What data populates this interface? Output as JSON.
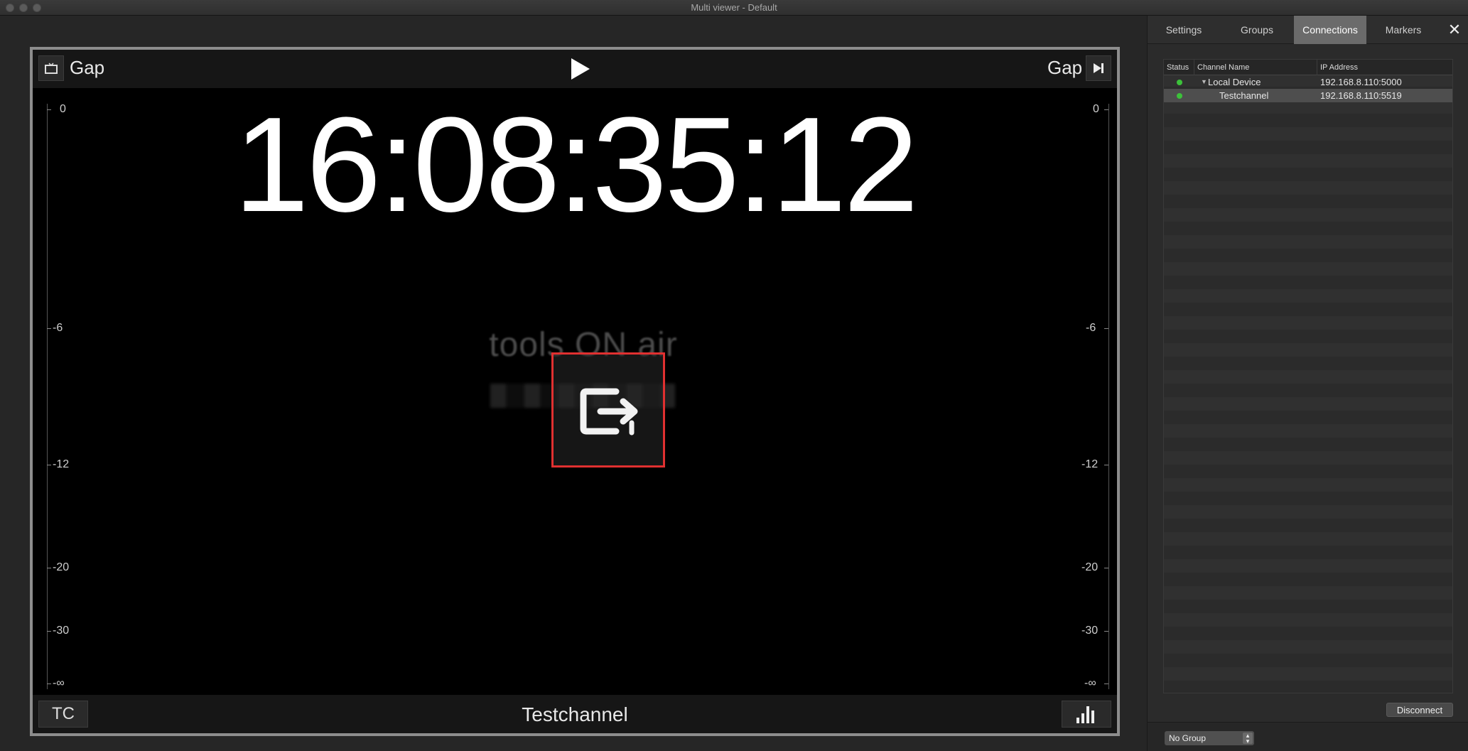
{
  "window": {
    "title": "Multi viewer - Default"
  },
  "viewer": {
    "left_label": "Gap",
    "right_label": "Gap",
    "timecode": "16:08:35:12",
    "tc_button": "TC",
    "channel_name": "Testchannel",
    "logo_text": "tools ON air",
    "scale_ticks": [
      "0",
      "-6",
      "-12",
      "-20",
      "-30",
      "-∞"
    ]
  },
  "sidebar": {
    "tabs": [
      {
        "label": "Settings"
      },
      {
        "label": "Groups"
      },
      {
        "label": "Connections",
        "active": true
      },
      {
        "label": "Markers"
      }
    ],
    "close_glyph": "✕",
    "table": {
      "headers": [
        "Status",
        "Channel Name",
        "IP Address"
      ],
      "rows": [
        {
          "status": "connected",
          "name": "Local Device",
          "ip": "192.168.8.110:5000",
          "expanded": true,
          "level": 0
        },
        {
          "status": "connected",
          "name": "Testchannel",
          "ip": "192.168.8.110:5519",
          "level": 1,
          "selected": true
        }
      ]
    },
    "disconnect_label": "Disconnect",
    "group_select": {
      "value": "No Group"
    }
  },
  "colors": {
    "status_green": "#3cc13a",
    "overlay_red": "#e03030",
    "active_tab": "#6b6b6b"
  },
  "icons": {
    "left_button": "monitor-icon",
    "play": "play-icon",
    "right_button": "skip-to-end-icon",
    "overlay": "output-arrow-icon",
    "meter_button": "bar-chart-icon"
  }
}
